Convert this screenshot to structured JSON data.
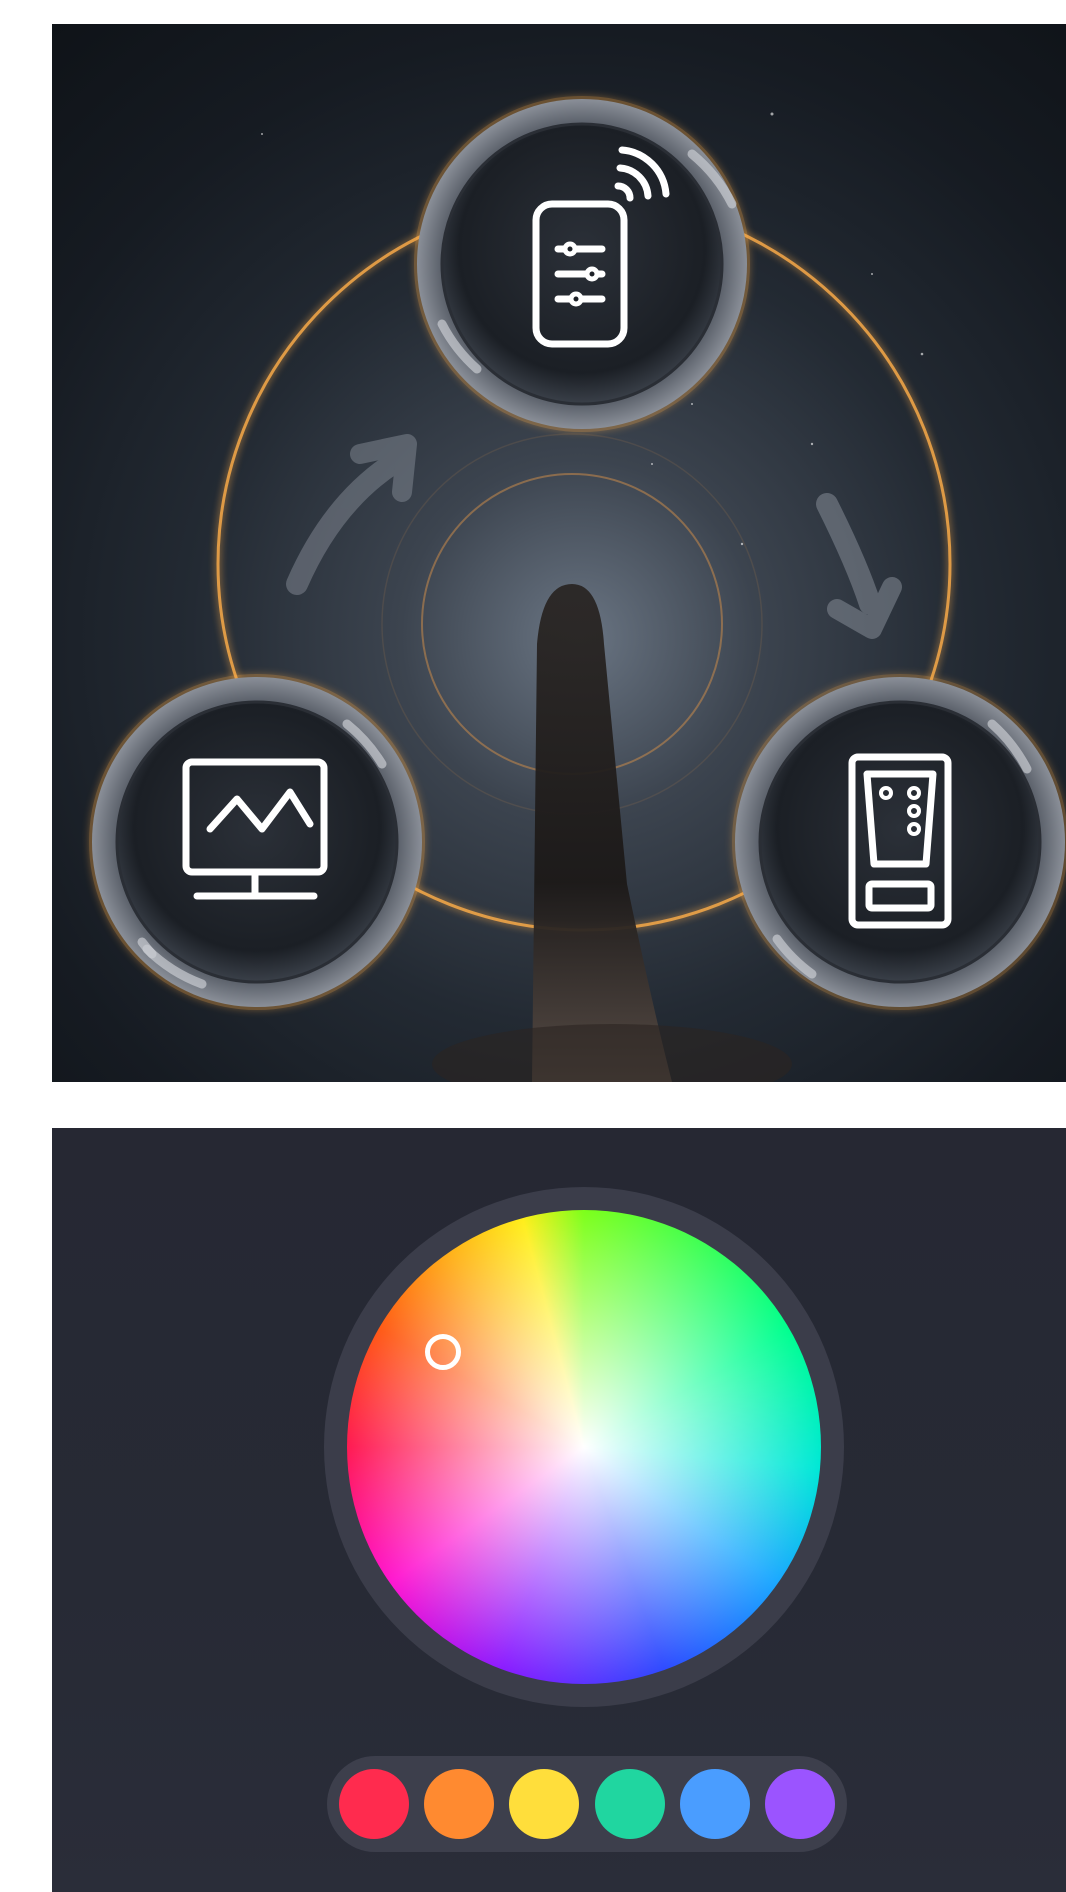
{
  "colors": {
    "glow": "#ffae4a",
    "swatches": [
      "#ff2b4e",
      "#ff8a30",
      "#ffde3b",
      "#20d6a0",
      "#4a9dff",
      "#9b54ff"
    ]
  },
  "workflow": {
    "nodes": [
      {
        "name": "phone-control-node",
        "icon": "smartphone-sliders-wifi-icon"
      },
      {
        "name": "monitor-node",
        "icon": "monitor-chart-icon"
      },
      {
        "name": "wall-panel-node",
        "icon": "wall-switch-panel-icon"
      }
    ]
  },
  "color_picker": {
    "selected_hue": "orange-red"
  }
}
